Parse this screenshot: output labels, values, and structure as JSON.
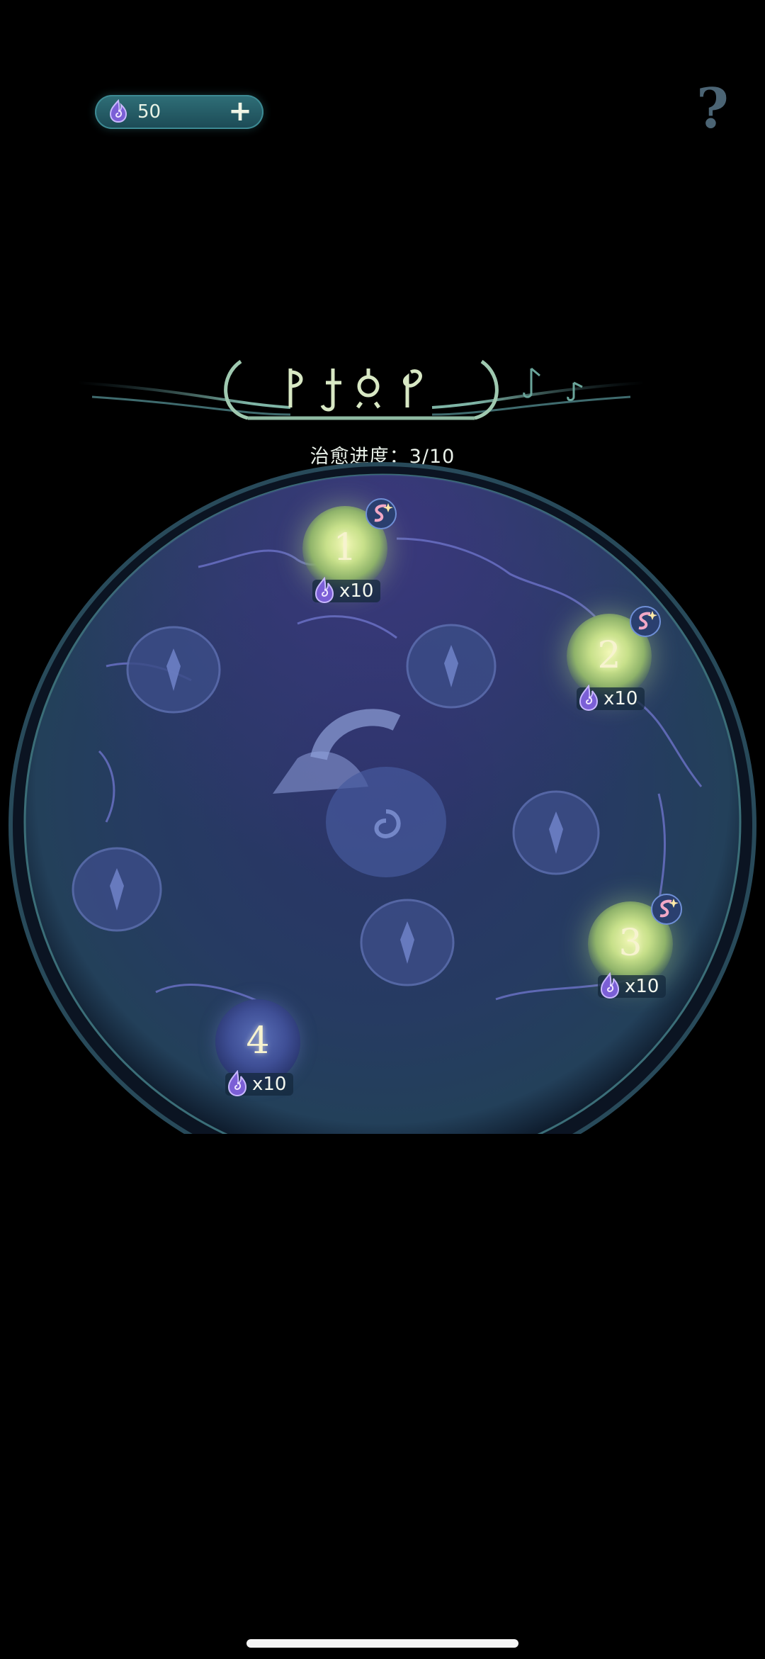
{
  "currency": {
    "amount": "50",
    "add_label": "+",
    "icon": "purple-flame-icon"
  },
  "help": {
    "label": "?"
  },
  "banner": {
    "decor": "ornate-glyph-banner"
  },
  "progress": {
    "text": "治愈进度：3/10"
  },
  "nodes": [
    {
      "number": "1",
      "cost": "x10",
      "state": "unlocked"
    },
    {
      "number": "2",
      "cost": "x10",
      "state": "unlocked"
    },
    {
      "number": "3",
      "cost": "x10",
      "state": "unlocked"
    },
    {
      "number": "4",
      "cost": "x10",
      "state": "locked-available"
    }
  ],
  "colors": {
    "accent_teal": "#2f6f78",
    "glow_yellow": "#f1f7b4",
    "plate_blue": "#2b3c6d",
    "flame_purple": "#8a6ad8"
  }
}
